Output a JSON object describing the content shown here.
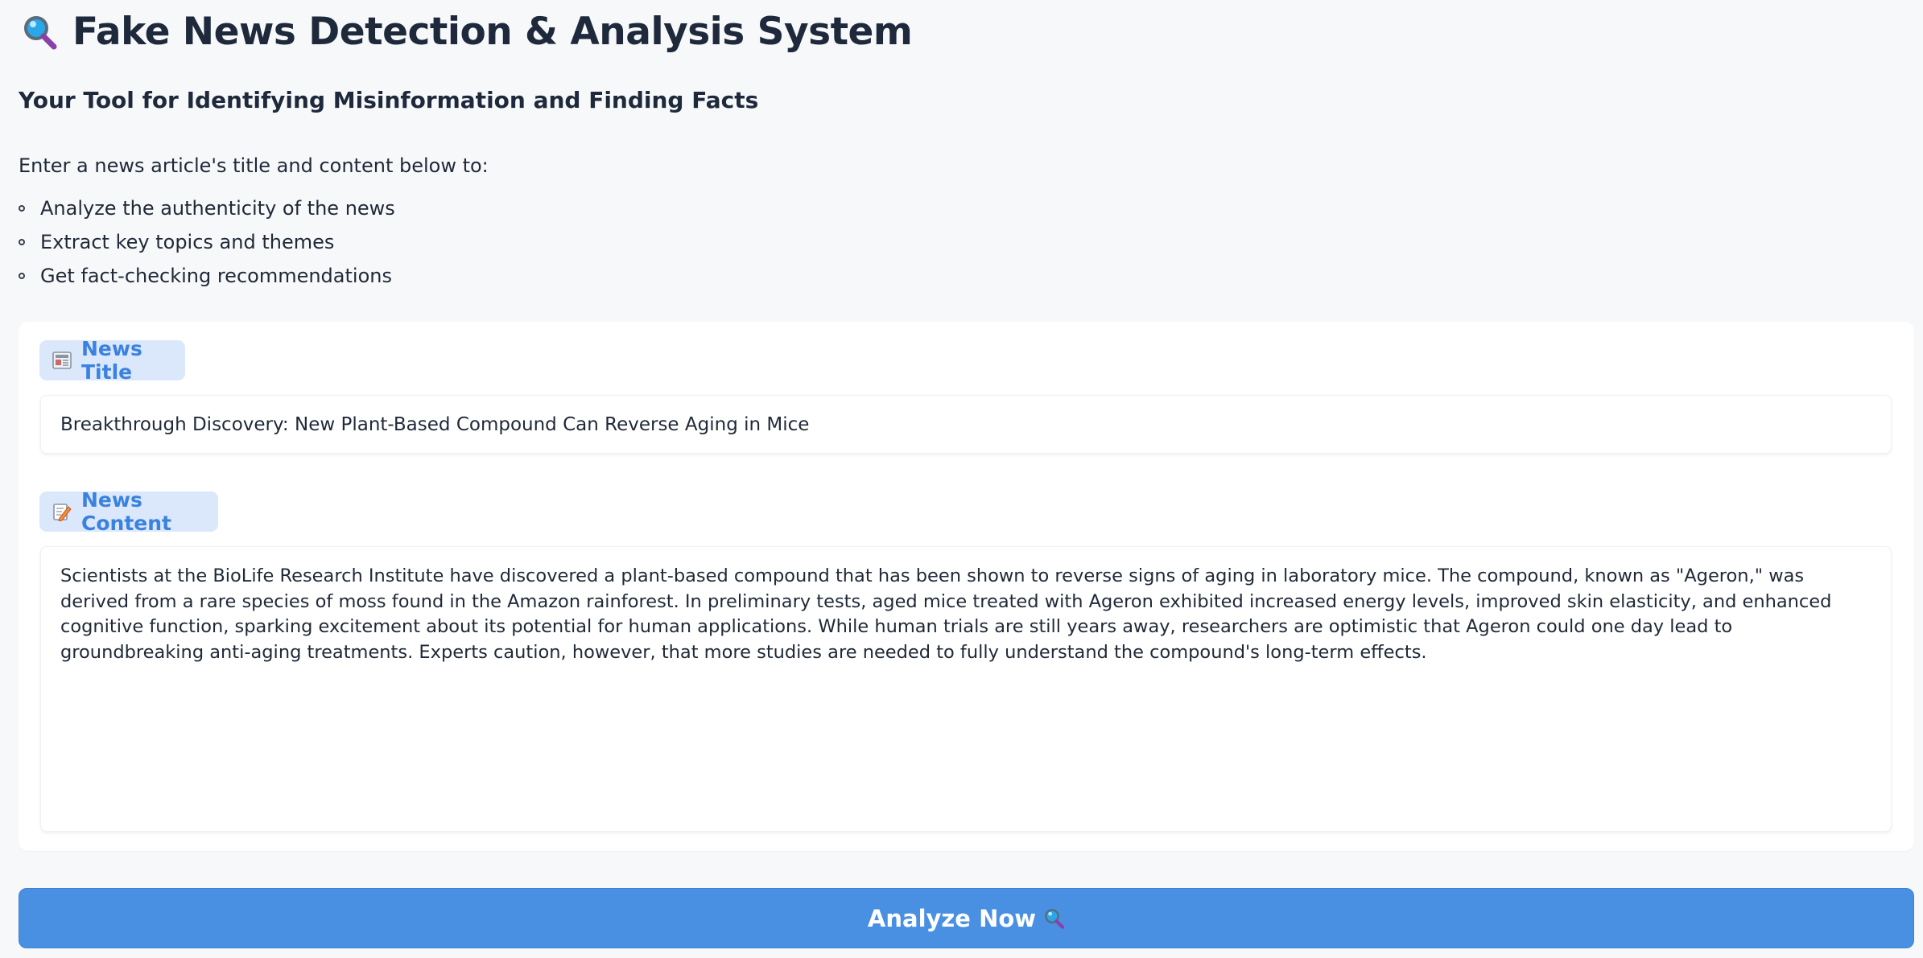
{
  "header": {
    "icon": "magnifier-icon",
    "title": "Fake News Detection & Analysis System",
    "subtitle": "Your Tool for Identifying Misinformation and Finding Facts"
  },
  "intro": {
    "text": "Enter a news article's title and content below to:",
    "features": [
      "Analyze the authenticity of the news",
      "Extract key topics and themes",
      "Get fact-checking recommendations"
    ]
  },
  "form": {
    "title_label": "News Title",
    "title_icon": "newspaper-icon",
    "title_value": "Breakthrough Discovery: New Plant-Based Compound Can Reverse Aging in Mice",
    "content_label": "News Content",
    "content_icon": "memo-icon",
    "content_value": "Scientists at the BioLife Research Institute have discovered a plant-based compound that has been shown to reverse signs of aging in laboratory mice. The compound, known as \"Ageron,\" was derived from a rare species of moss found in the Amazon rainforest. In preliminary tests, aged mice treated with Ageron exhibited increased energy levels, improved skin elasticity, and enhanced cognitive function, sparking excitement about its potential for human applications. While human trials are still years away, researchers are optimistic that Ageron could one day lead to groundbreaking anti-aging treatments. Experts caution, however, that more studies are needed to fully understand the compound's long-term effects."
  },
  "actions": {
    "analyze_label": "Analyze Now",
    "analyze_icon": "magnifier-icon"
  },
  "colors": {
    "accent": "#4a90e2",
    "chip_bg": "#dbe8fb",
    "chip_text": "#3b82e0",
    "background": "#f7f8fa"
  }
}
